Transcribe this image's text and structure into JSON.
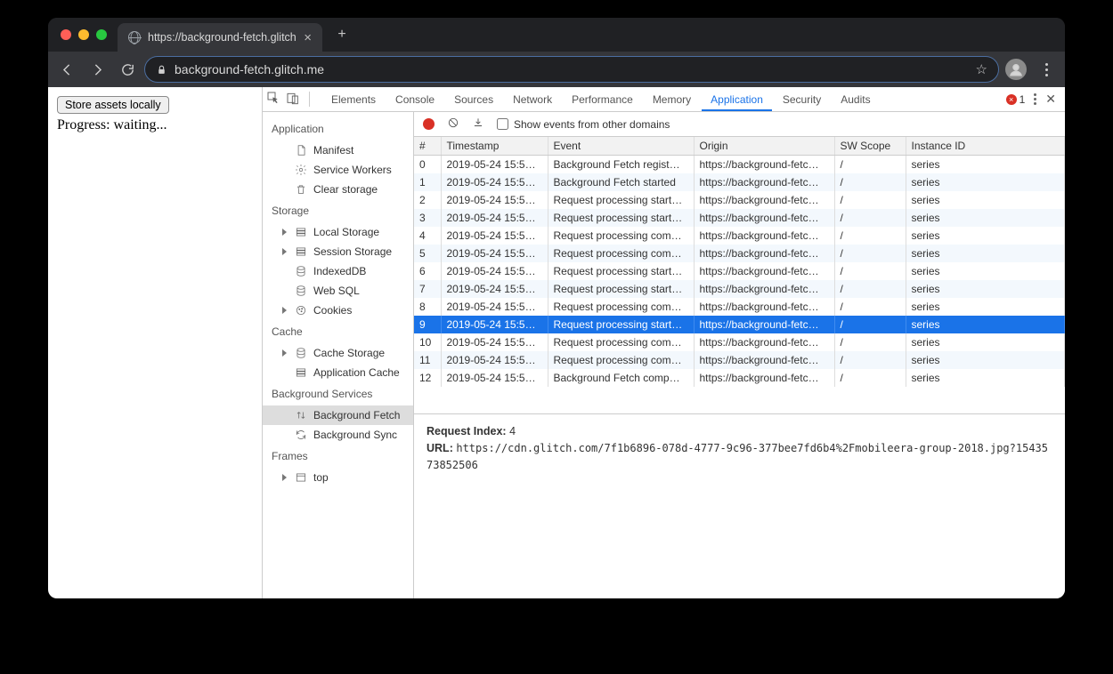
{
  "browser": {
    "tab_title": "https://background-fetch.glitch",
    "url_display": "background-fetch.glitch.me"
  },
  "page": {
    "button_label": "Store assets locally",
    "progress_text": "Progress: waiting..."
  },
  "devtools": {
    "tabs": [
      "Elements",
      "Console",
      "Sources",
      "Network",
      "Performance",
      "Memory",
      "Application",
      "Security",
      "Audits"
    ],
    "active_tab": "Application",
    "error_count": "1",
    "sidebar": {
      "sections": [
        {
          "title": "Application",
          "items": [
            {
              "label": "Manifest",
              "icon": "doc"
            },
            {
              "label": "Service Workers",
              "icon": "gear"
            },
            {
              "label": "Clear storage",
              "icon": "trash"
            }
          ]
        },
        {
          "title": "Storage",
          "items": [
            {
              "label": "Local Storage",
              "icon": "db",
              "expander": true
            },
            {
              "label": "Session Storage",
              "icon": "db",
              "expander": true
            },
            {
              "label": "IndexedDB",
              "icon": "stack"
            },
            {
              "label": "Web SQL",
              "icon": "stack"
            },
            {
              "label": "Cookies",
              "icon": "cookie",
              "expander": true
            }
          ]
        },
        {
          "title": "Cache",
          "items": [
            {
              "label": "Cache Storage",
              "icon": "stack",
              "expander": true
            },
            {
              "label": "Application Cache",
              "icon": "db"
            }
          ]
        },
        {
          "title": "Background Services",
          "items": [
            {
              "label": "Background Fetch",
              "icon": "updown",
              "active": true
            },
            {
              "label": "Background Sync",
              "icon": "sync"
            }
          ]
        },
        {
          "title": "Frames",
          "items": [
            {
              "label": "top",
              "icon": "frame",
              "expander": true
            }
          ]
        }
      ]
    },
    "toolbar": {
      "show_other_domains": "Show events from other domains"
    },
    "table": {
      "headers": [
        "#",
        "Timestamp",
        "Event",
        "Origin",
        "SW Scope",
        "Instance ID"
      ],
      "rows": [
        {
          "idx": "0",
          "ts": "2019-05-24 15:5…",
          "event": "Background Fetch regist…",
          "origin": "https://background-fetc…",
          "scope": "/",
          "iid": "series"
        },
        {
          "idx": "1",
          "ts": "2019-05-24 15:5…",
          "event": "Background Fetch started",
          "origin": "https://background-fetc…",
          "scope": "/",
          "iid": "series"
        },
        {
          "idx": "2",
          "ts": "2019-05-24 15:5…",
          "event": "Request processing start…",
          "origin": "https://background-fetc…",
          "scope": "/",
          "iid": "series"
        },
        {
          "idx": "3",
          "ts": "2019-05-24 15:5…",
          "event": "Request processing start…",
          "origin": "https://background-fetc…",
          "scope": "/",
          "iid": "series"
        },
        {
          "idx": "4",
          "ts": "2019-05-24 15:5…",
          "event": "Request processing com…",
          "origin": "https://background-fetc…",
          "scope": "/",
          "iid": "series"
        },
        {
          "idx": "5",
          "ts": "2019-05-24 15:5…",
          "event": "Request processing com…",
          "origin": "https://background-fetc…",
          "scope": "/",
          "iid": "series"
        },
        {
          "idx": "6",
          "ts": "2019-05-24 15:5…",
          "event": "Request processing start…",
          "origin": "https://background-fetc…",
          "scope": "/",
          "iid": "series"
        },
        {
          "idx": "7",
          "ts": "2019-05-24 15:5…",
          "event": "Request processing start…",
          "origin": "https://background-fetc…",
          "scope": "/",
          "iid": "series"
        },
        {
          "idx": "8",
          "ts": "2019-05-24 15:5…",
          "event": "Request processing com…",
          "origin": "https://background-fetc…",
          "scope": "/",
          "iid": "series"
        },
        {
          "idx": "9",
          "ts": "2019-05-24 15:5…",
          "event": "Request processing start…",
          "origin": "https://background-fetc…",
          "scope": "/",
          "iid": "series",
          "selected": true
        },
        {
          "idx": "10",
          "ts": "2019-05-24 15:5…",
          "event": "Request processing com…",
          "origin": "https://background-fetc…",
          "scope": "/",
          "iid": "series"
        },
        {
          "idx": "11",
          "ts": "2019-05-24 15:5…",
          "event": "Request processing com…",
          "origin": "https://background-fetc…",
          "scope": "/",
          "iid": "series"
        },
        {
          "idx": "12",
          "ts": "2019-05-24 15:5…",
          "event": "Background Fetch comp…",
          "origin": "https://background-fetc…",
          "scope": "/",
          "iid": "series"
        }
      ]
    },
    "details": {
      "request_index_label": "Request Index:",
      "request_index_value": "4",
      "url_label": "URL:",
      "url_value": "https://cdn.glitch.com/7f1b6896-078d-4777-9c96-377bee7fd6b4%2Fmobileera-group-2018.jpg?1543573852506"
    }
  }
}
